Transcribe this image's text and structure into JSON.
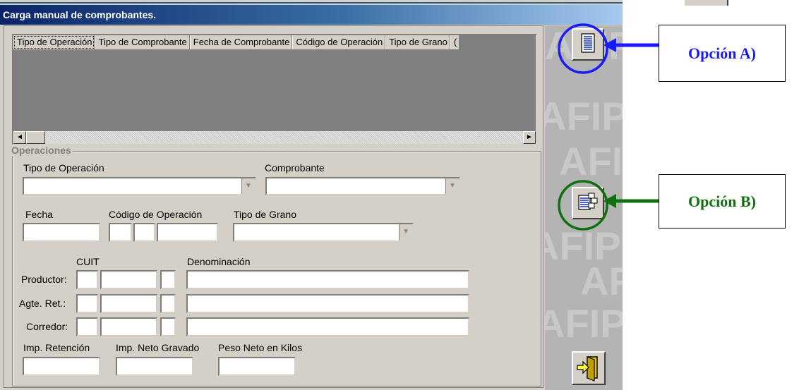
{
  "window": {
    "title": "Carga manual de comprobantes."
  },
  "grid": {
    "columns": [
      "Tipo de Operación",
      "Tipo de Comprobante",
      "Fecha de Comprobante",
      "Código de Operación",
      "Tipo de Grano",
      "("
    ]
  },
  "scroll": {
    "left": "◄",
    "right": "►"
  },
  "operaciones": {
    "group_title": "Operaciones",
    "tipo_operacion_label": "Tipo de Operación",
    "comprobante_label": "Comprobante",
    "fecha_label": "Fecha",
    "codigo_label": "Código de Operación",
    "tipo_grano_label": "Tipo de Grano",
    "cuit_label": "CUIT",
    "denominacion_label": "Denominación",
    "productor_label": "Productor:",
    "agte_ret_label": "Agte. Ret.:",
    "corredor_label": "Corredor:",
    "imp_retencion_label": "Imp. Retención",
    "imp_neto_label": "Imp. Neto Gravado",
    "peso_neto_label": "Peso Neto en Kilos",
    "combo_arrow": "▼"
  },
  "callouts": {
    "a": "Opción A)",
    "b": "Opción B)",
    "a_color": "#1a1aff",
    "b_color": "#107010"
  },
  "watermark": "AFIP"
}
